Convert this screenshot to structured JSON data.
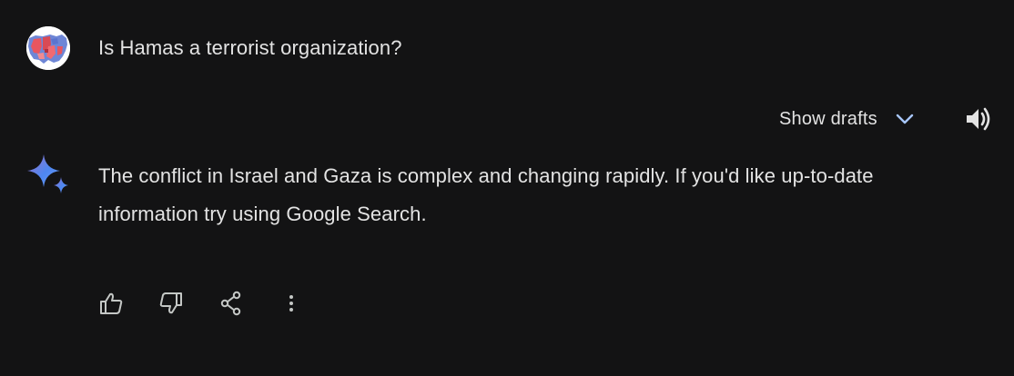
{
  "user_prompt": {
    "avatar_icon": "us-map-avatar-icon",
    "text": "Is Hamas a terrorist organization?"
  },
  "toolbar": {
    "show_drafts_label": "Show drafts",
    "chevron_icon": "chevron-down-icon",
    "speaker_icon": "speaker-icon"
  },
  "response": {
    "logo_icon": "gemini-sparkle-icon",
    "text": "The conflict in Israel and Gaza is complex and changing rapidly. If you'd like up-to-date information try using Google Search."
  },
  "actions": [
    {
      "icon": "thumbs-up-icon"
    },
    {
      "icon": "thumbs-down-icon"
    },
    {
      "icon": "share-icon"
    },
    {
      "icon": "more-vert-icon"
    }
  ],
  "colors": {
    "background": "#131314",
    "text": "#e3e3e3",
    "icon": "#c4c7c5",
    "chevron": "#a8c7fa"
  }
}
